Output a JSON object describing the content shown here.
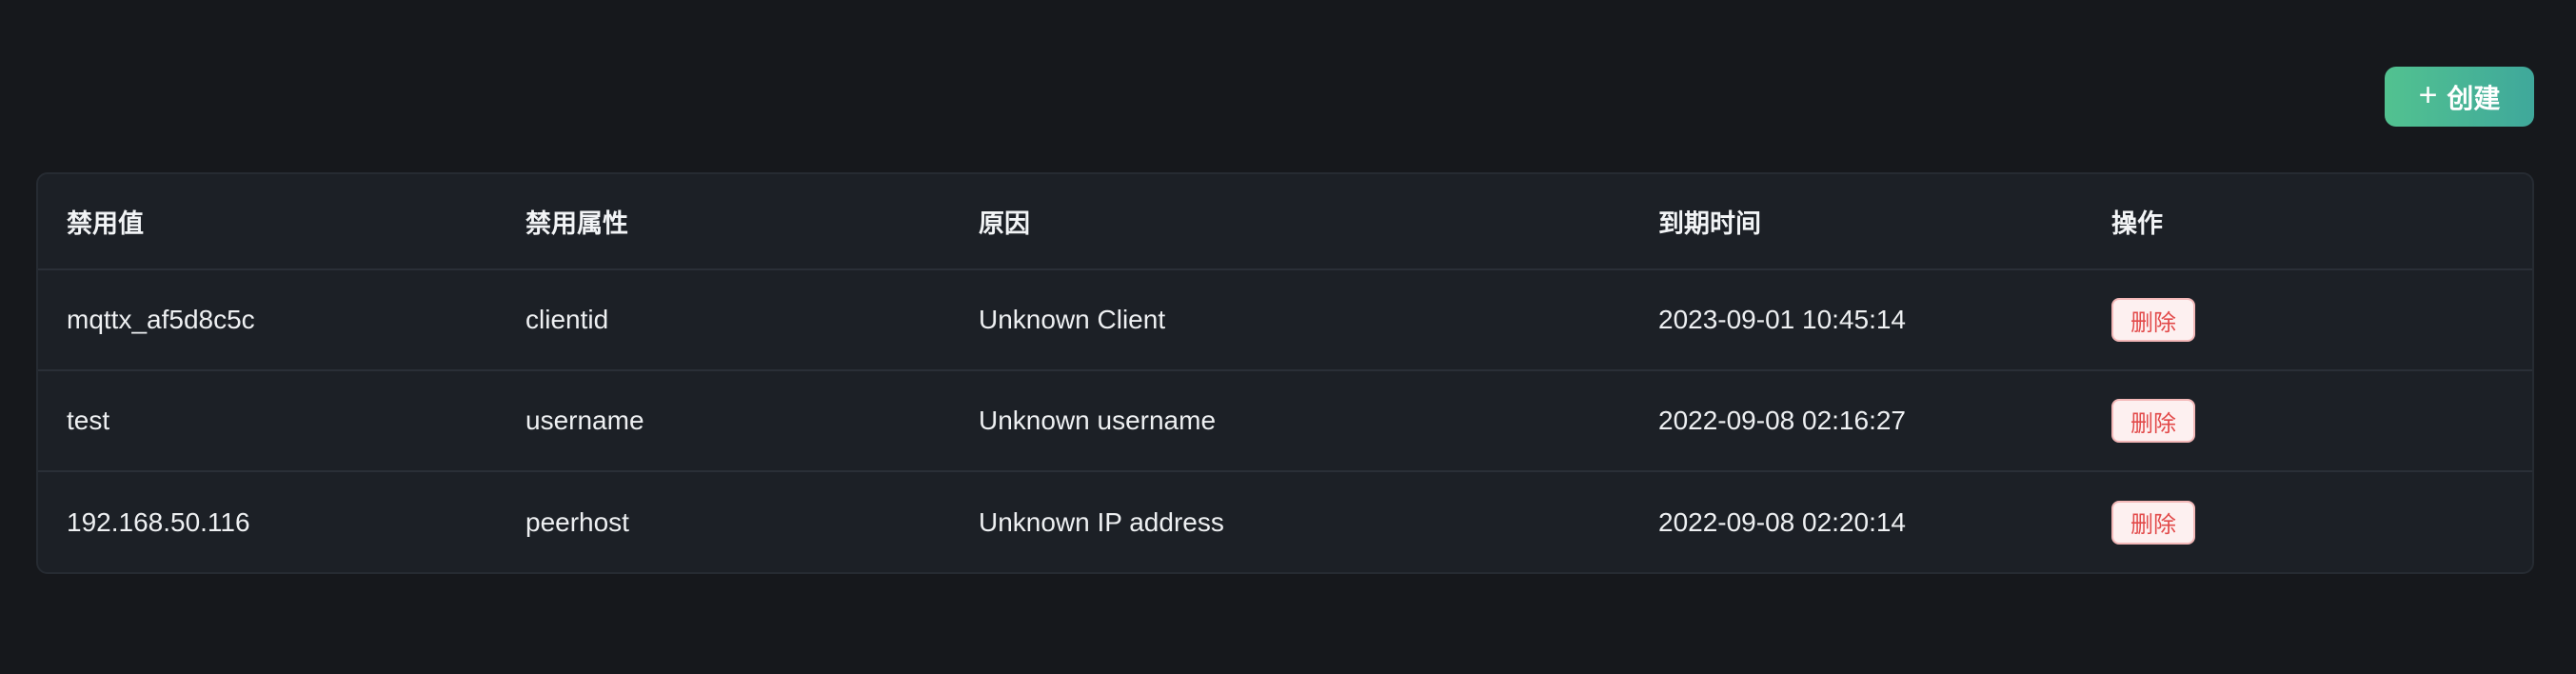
{
  "toolbar": {
    "create_label": "创建",
    "plus_symbol": "+"
  },
  "table": {
    "headers": [
      "禁用值",
      "禁用属性",
      "原因",
      "到期时间",
      "操作"
    ],
    "rows": [
      {
        "value": "mqttx_af5d8c5c",
        "attribute": "clientid",
        "reason": "Unknown Client",
        "expires": "2023-09-01 10:45:14",
        "action": "删除"
      },
      {
        "value": "test",
        "attribute": "username",
        "reason": "Unknown username",
        "expires": "2022-09-08 02:16:27",
        "action": "删除"
      },
      {
        "value": "192.168.50.116",
        "attribute": "peerhost",
        "reason": "Unknown IP address",
        "expires": "2022-09-08 02:20:14",
        "action": "删除"
      }
    ]
  },
  "colors": {
    "background": "#16181c",
    "card": "#1c2026",
    "accent_start": "#52c290",
    "accent_end": "#3fa89b",
    "danger": "#e24a4a"
  }
}
